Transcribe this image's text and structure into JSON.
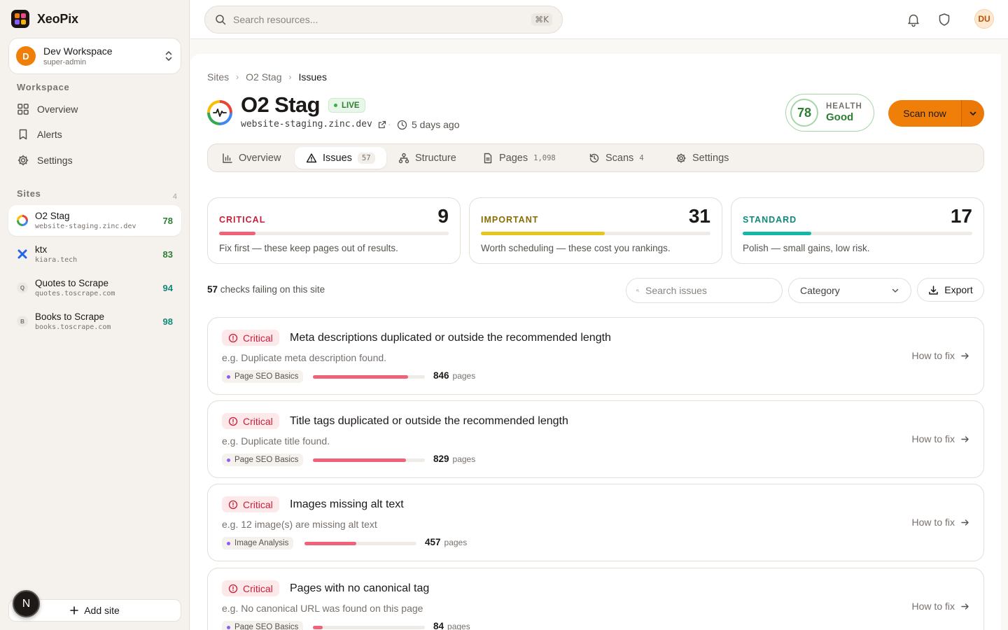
{
  "app": {
    "name": "XeoPix"
  },
  "workspace": {
    "initial": "D",
    "name": "Dev Workspace",
    "role": "super-admin"
  },
  "sidebar": {
    "workspace_label": "Workspace",
    "nav": [
      {
        "label": "Overview",
        "icon": "grid-icon"
      },
      {
        "label": "Alerts",
        "icon": "bookmark-icon"
      },
      {
        "label": "Settings",
        "icon": "gear-icon"
      }
    ],
    "sites_label": "Sites",
    "sites_count": "4",
    "sites": [
      {
        "name": "O2 Stag",
        "domain": "website-staging.zinc.dev",
        "score": "78",
        "score_color": "#2e7d32",
        "icon": "O2",
        "active": true
      },
      {
        "name": "ktx",
        "domain": "kiara.tech",
        "score": "83",
        "score_color": "#2e7d32",
        "icon": "K"
      },
      {
        "name": "Quotes to Scrape",
        "domain": "quotes.toscrape.com",
        "score": "94",
        "score_color": "#0f8a7a",
        "icon": "Q"
      },
      {
        "name": "Books to Scrape",
        "domain": "books.toscrape.com",
        "score": "98",
        "score_color": "#0f8a7a",
        "icon": "B"
      }
    ],
    "add_site": "Add site",
    "bottom_badge": "N"
  },
  "topbar": {
    "search_placeholder": "Search resources...",
    "shortcut": "⌘K",
    "user_initials": "DU"
  },
  "breadcrumb": [
    "Sites",
    "O2 Stag",
    "Issues"
  ],
  "site": {
    "title": "O2 Stag",
    "status": "LIVE",
    "domain": "website-staging.zinc.dev",
    "last_scan": "5 days ago",
    "health_score": "78",
    "health_label": "HEALTH",
    "health_status": "Good"
  },
  "scan_button": "Scan now",
  "tabs": [
    {
      "label": "Overview",
      "count": ""
    },
    {
      "label": "Issues",
      "count": "57",
      "active": true
    },
    {
      "label": "Structure",
      "count": ""
    },
    {
      "label": "Pages",
      "count": "1,098"
    },
    {
      "label": "Scans",
      "count": "4"
    },
    {
      "label": "Settings",
      "count": ""
    }
  ],
  "stats": [
    {
      "label": "CRITICAL",
      "count": "9",
      "desc": "Fix first — these keep pages out of results.",
      "color": "#c81e3a",
      "bar_color": "#f06277",
      "fill_fraction": 0.16
    },
    {
      "label": "IMPORTANT",
      "count": "31",
      "desc": "Worth scheduling — these cost you rankings.",
      "color": "#8a6d00",
      "bar_color": "#e7c51c",
      "fill_fraction": 0.54
    },
    {
      "label": "STANDARD",
      "count": "17",
      "desc": "Polish — small gains, low risk.",
      "color": "#0f8a7a",
      "bar_color": "#14b8a6",
      "fill_fraction": 0.3
    }
  ],
  "toolbar": {
    "fail_count": "57",
    "fail_text": "checks failing on this site",
    "search_placeholder": "Search issues",
    "category_label": "Category",
    "export_label": "Export"
  },
  "issues": [
    {
      "severity": "Critical",
      "title": "Meta descriptions duplicated or outside the recommended length",
      "example": "e.g. Duplicate meta description found.",
      "category": "Page SEO Basics",
      "pages": "846",
      "pages_unit": "pages",
      "fill_fraction": 0.85,
      "howto": "How to fix"
    },
    {
      "severity": "Critical",
      "title": "Title tags duplicated or outside the recommended length",
      "example": "e.g. Duplicate title found.",
      "category": "Page SEO Basics",
      "pages": "829",
      "pages_unit": "pages",
      "fill_fraction": 0.83,
      "howto": "How to fix"
    },
    {
      "severity": "Critical",
      "title": "Images missing alt text",
      "example": "e.g. 12 image(s) are missing alt text",
      "category": "Image Analysis",
      "pages": "457",
      "pages_unit": "pages",
      "fill_fraction": 0.46,
      "howto": "How to fix"
    },
    {
      "severity": "Critical",
      "title": "Pages with no canonical tag",
      "example": "e.g. No canonical URL was found on this page",
      "category": "Page SEO Basics",
      "pages": "84",
      "pages_unit": "pages",
      "fill_fraction": 0.09,
      "howto": "How to fix"
    }
  ]
}
